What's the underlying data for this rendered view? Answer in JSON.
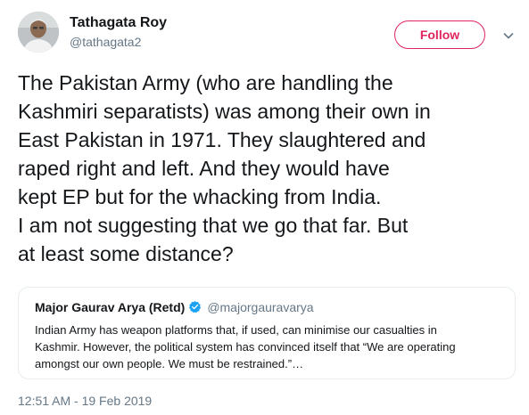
{
  "author": {
    "name": "Tathagata Roy",
    "handle": "@tathagata2",
    "avatar_icon": "user-avatar"
  },
  "follow_button": {
    "label": "Follow",
    "color": "#e0245e"
  },
  "menu_icon": "chevron-down-icon",
  "tweet": {
    "lines": [
      "The Pakistan Army (who are handling the",
      "Kashmiri separatists) was among their own in",
      "East Pakistan in 1971. They slaughtered and",
      "raped right and left. And they would have",
      "kept EP but for the whacking from India.",
      "I am not suggesting that we go that far. But",
      "at least some distance?"
    ]
  },
  "quoted_tweet": {
    "name": "Major Gaurav Arya (Retd)",
    "verified_icon": "verified-badge-icon",
    "handle": "@majorgauravarya",
    "lines": [
      "Indian Army has weapon platforms that, if used, can minimise our casualties in",
      "Kashmir. However, the political system has convinced itself that “We are operating",
      "amongst our own people. We must be restrained.”…"
    ]
  },
  "timestamp": "12:51 AM - 19 Feb 2019",
  "colors": {
    "text_primary": "#14171a",
    "text_secondary": "#657786",
    "verified_blue": "#1da1f2",
    "border": "#e6ecf0"
  }
}
